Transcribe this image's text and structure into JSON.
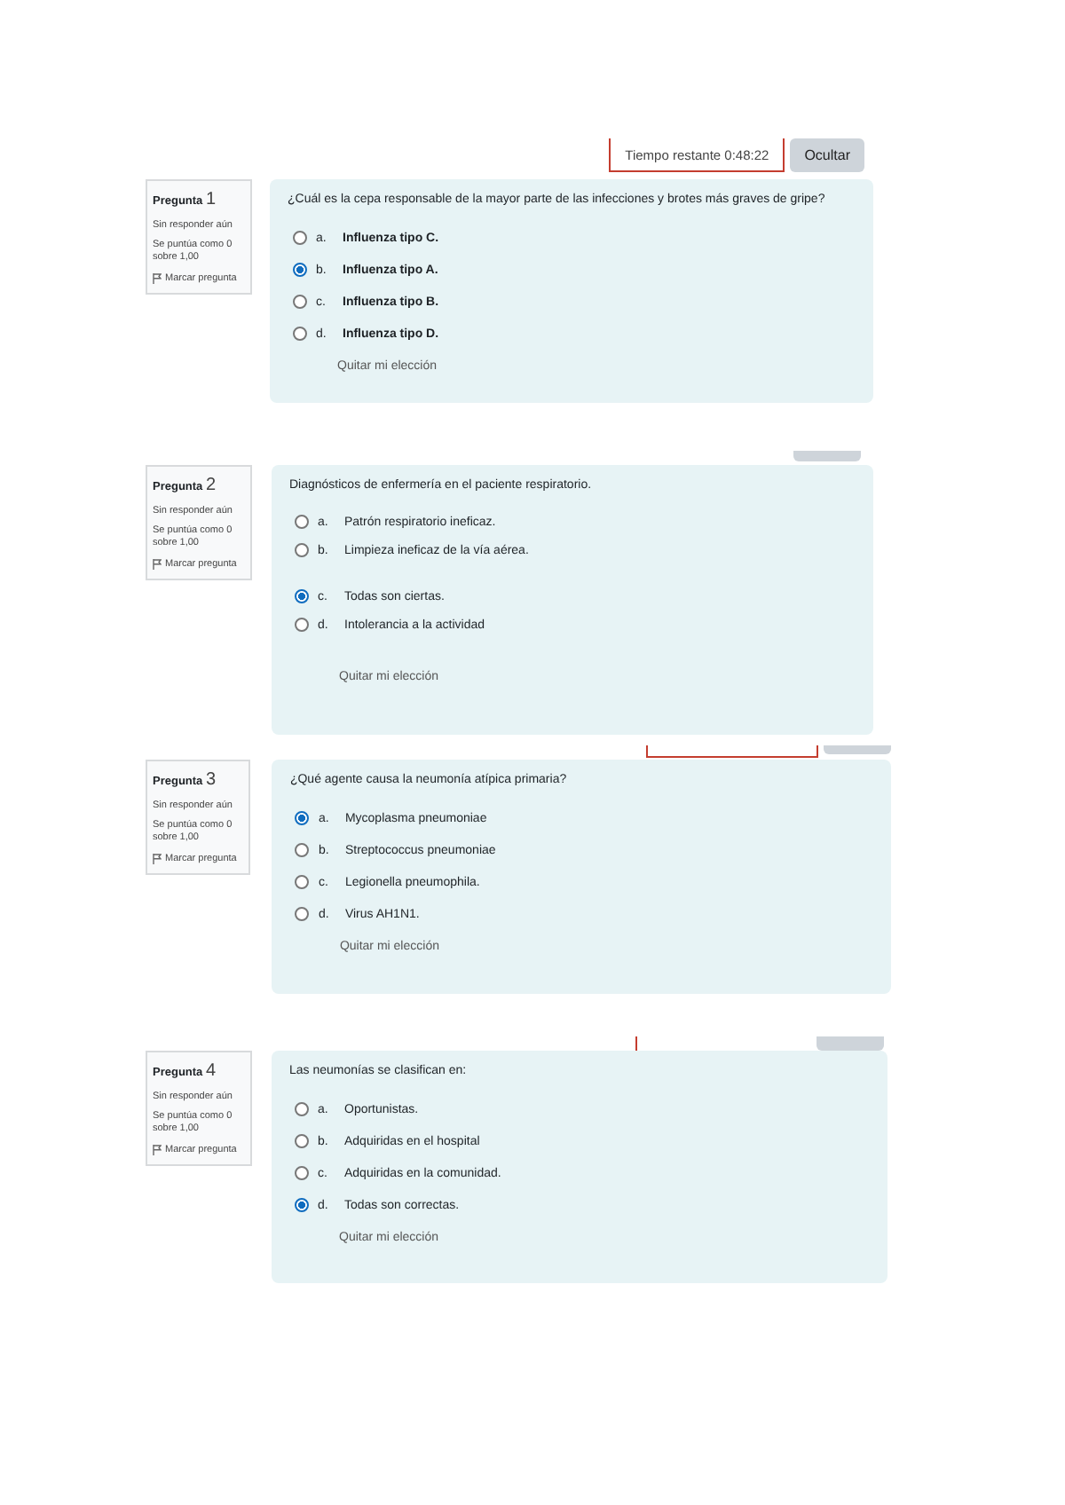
{
  "timer": {
    "label": "Tiempo restante 0:48:22",
    "button": "Ocultar"
  },
  "questions": [
    {
      "heading": "Pregunta",
      "number": "1",
      "status": "Sin responder aún",
      "score": "Se puntúa como 0 sobre 1,00",
      "flag": "Marcar pregunta",
      "text": "¿Cuál es la cepa responsable de la mayor parte de las infecciones y brotes más graves de gripe?",
      "clear": "Quitar mi elección",
      "options": [
        {
          "letter": "a.",
          "text": "Influenza tipo C.",
          "selected": false
        },
        {
          "letter": "b.",
          "text": "Influenza tipo A.",
          "selected": true
        },
        {
          "letter": "c.",
          "text": "Influenza tipo B.",
          "selected": false
        },
        {
          "letter": "d.",
          "text": "Influenza tipo D.",
          "selected": false
        }
      ]
    },
    {
      "heading": "Pregunta",
      "number": "2",
      "status": "Sin responder aún",
      "score": "Se puntúa como 0 sobre 1,00",
      "flag": "Marcar pregunta",
      "text": "Diagnósticos de enfermería en el paciente respiratorio.",
      "clear": "Quitar mi elección",
      "options": [
        {
          "letter": "a.",
          "text": "Patrón respiratorio ineficaz.",
          "selected": false
        },
        {
          "letter": "b.",
          "text": "Limpieza ineficaz de la vía aérea.",
          "selected": false
        },
        {
          "letter": "c.",
          "text": "Todas son ciertas.",
          "selected": true
        },
        {
          "letter": "d.",
          "text": "Intolerancia a la actividad",
          "selected": false
        }
      ]
    },
    {
      "heading": "Pregunta",
      "number": "3",
      "status": "Sin responder aún",
      "score": "Se puntúa como 0 sobre 1,00",
      "flag": "Marcar pregunta",
      "text": "¿Qué agente causa la neumonía atípica primaria?",
      "clear": "Quitar mi elección",
      "options": [
        {
          "letter": "a.",
          "text": "Mycoplasma pneumoniae",
          "selected": true
        },
        {
          "letter": "b.",
          "text": "Streptococcus pneumoniae",
          "selected": false
        },
        {
          "letter": "c.",
          "text": "Legionella pneumophila.",
          "selected": false
        },
        {
          "letter": "d.",
          "text": "Virus AH1N1.",
          "selected": false
        }
      ]
    },
    {
      "heading": "Pregunta",
      "number": "4",
      "status": "Sin responder aún",
      "score": "Se puntúa como 0 sobre 1,00",
      "flag": "Marcar pregunta",
      "text": "Las neumonías se clasifican en:",
      "clear": "Quitar mi elección",
      "options": [
        {
          "letter": "a.",
          "text": "Oportunistas.",
          "selected": false
        },
        {
          "letter": "b.",
          "text": "Adquiridas en el hospital",
          "selected": false
        },
        {
          "letter": "c.",
          "text": "Adquiridas en la comunidad.",
          "selected": false
        },
        {
          "letter": "d.",
          "text": "Todas son correctas.",
          "selected": true
        }
      ]
    }
  ]
}
